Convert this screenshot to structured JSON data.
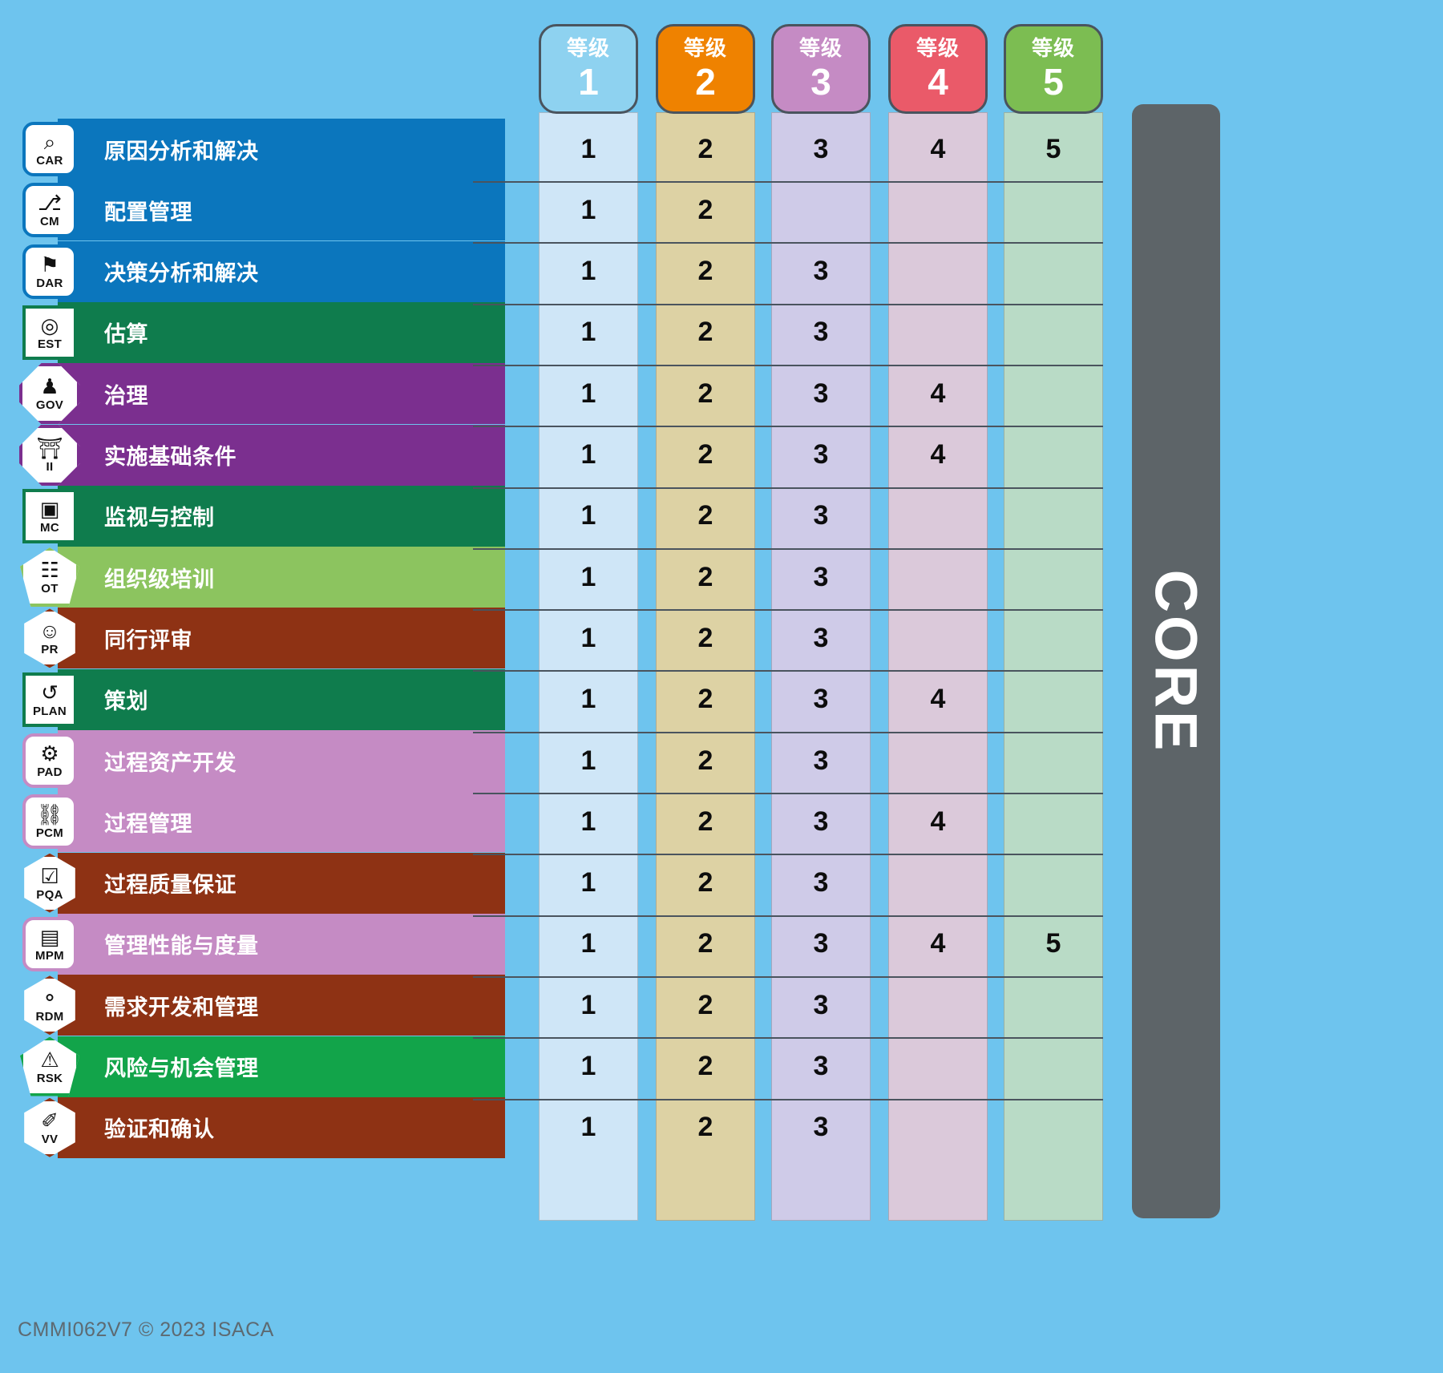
{
  "background_color": "#6ec4ee",
  "core_label": "CORE",
  "footer": "CMMI062V7 © 2023 ISACA",
  "level_headers": [
    {
      "label": "等级",
      "num": "1",
      "color": "#8ed2f0",
      "strip": "#cfe6f7"
    },
    {
      "label": "等级",
      "num": "2",
      "color": "#ef8200",
      "strip": "#ddd2a4"
    },
    {
      "label": "等级",
      "num": "3",
      "color": "#c58bc4",
      "strip": "#cfcbe8"
    },
    {
      "label": "等级",
      "num": "4",
      "color": "#ea5a69",
      "strip": "#dbc9da"
    },
    {
      "label": "等级",
      "num": "5",
      "color": "#7cbd52",
      "strip": "#b9dbc6"
    }
  ],
  "chart_data": {
    "type": "table",
    "title": "CMMI Practice Areas by Maturity Level",
    "columns": [
      "等级 1",
      "等级 2",
      "等级 3",
      "等级 4",
      "等级 5"
    ],
    "legend": [
      "CORE"
    ],
    "rows": [
      {
        "abbr": "CAR",
        "name": "原因分析和解决",
        "color": "#0b76bd",
        "shape": "round",
        "glyph": "⌕",
        "levels": [
          "1",
          "2",
          "3",
          "4",
          "5"
        ]
      },
      {
        "abbr": "CM",
        "name": "配置管理",
        "color": "#0b76bd",
        "shape": "round",
        "glyph": "⎇",
        "levels": [
          "1",
          "2",
          "",
          "",
          ""
        ]
      },
      {
        "abbr": "DAR",
        "name": "决策分析和解决",
        "color": "#0b76bd",
        "shape": "round",
        "glyph": "⚑",
        "levels": [
          "1",
          "2",
          "3",
          "",
          ""
        ]
      },
      {
        "abbr": "EST",
        "name": "估算",
        "color": "#0f7c4d",
        "shape": "square",
        "glyph": "◎",
        "levels": [
          "1",
          "2",
          "3",
          "",
          ""
        ]
      },
      {
        "abbr": "GOV",
        "name": "治理",
        "color": "#7b2f8f",
        "shape": "diamond",
        "glyph": "♟",
        "levels": [
          "1",
          "2",
          "3",
          "4",
          ""
        ]
      },
      {
        "abbr": "II",
        "name": "实施基础条件",
        "color": "#7b2f8f",
        "shape": "diamond",
        "glyph": "⛩",
        "levels": [
          "1",
          "2",
          "3",
          "4",
          ""
        ]
      },
      {
        "abbr": "MC",
        "name": "监视与控制",
        "color": "#0f7c4d",
        "shape": "square",
        "glyph": "▣",
        "levels": [
          "1",
          "2",
          "3",
          "",
          ""
        ]
      },
      {
        "abbr": "OT",
        "name": "组织级培训",
        "color": "#8cc45f",
        "shape": "pent",
        "glyph": "☷",
        "levels": [
          "1",
          "2",
          "3",
          "",
          ""
        ]
      },
      {
        "abbr": "PR",
        "name": "同行评审",
        "color": "#8e3214",
        "shape": "hex",
        "glyph": "☺",
        "levels": [
          "1",
          "2",
          "3",
          "",
          ""
        ]
      },
      {
        "abbr": "PLAN",
        "name": "策划",
        "color": "#0f7c4d",
        "shape": "square",
        "glyph": "↺",
        "levels": [
          "1",
          "2",
          "3",
          "4",
          ""
        ]
      },
      {
        "abbr": "PAD",
        "name": "过程资产开发",
        "color": "#c58bc4",
        "shape": "round",
        "glyph": "⚙",
        "levels": [
          "1",
          "2",
          "3",
          "",
          ""
        ]
      },
      {
        "abbr": "PCM",
        "name": "过程管理",
        "color": "#c58bc4",
        "shape": "round",
        "glyph": "⛓",
        "levels": [
          "1",
          "2",
          "3",
          "4",
          ""
        ]
      },
      {
        "abbr": "PQA",
        "name": "过程质量保证",
        "color": "#8e3214",
        "shape": "hex",
        "glyph": "☑",
        "levels": [
          "1",
          "2",
          "3",
          "",
          ""
        ]
      },
      {
        "abbr": "MPM",
        "name": "管理性能与度量",
        "color": "#c58bc4",
        "shape": "round",
        "glyph": "▤",
        "levels": [
          "1",
          "2",
          "3",
          "4",
          "5"
        ]
      },
      {
        "abbr": "RDM",
        "name": "需求开发和管理",
        "color": "#8e3214",
        "shape": "hex",
        "glyph": "⚬",
        "levels": [
          "1",
          "2",
          "3",
          "",
          ""
        ]
      },
      {
        "abbr": "RSK",
        "name": "风险与机会管理",
        "color": "#12a44a",
        "shape": "pent",
        "glyph": "⚠",
        "levels": [
          "1",
          "2",
          "3",
          "",
          ""
        ]
      },
      {
        "abbr": "VV",
        "name": "验证和确认",
        "color": "#8e3214",
        "shape": "hex",
        "glyph": "✐",
        "levels": [
          "1",
          "2",
          "3",
          "",
          ""
        ]
      }
    ]
  }
}
